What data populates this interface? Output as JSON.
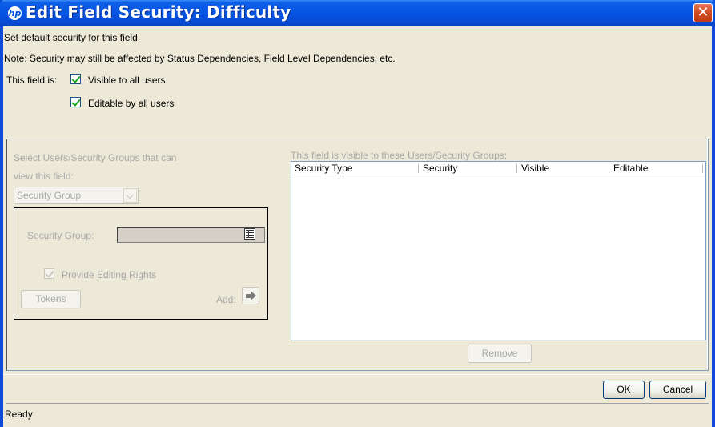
{
  "window": {
    "title": "Edit Field Security: Difficulty",
    "logo_text": "hp"
  },
  "intro": {
    "line1": "Set default security for this field.",
    "line2": "Note: Security may still be affected by Status Dependencies, Field Level Dependencies, etc."
  },
  "defaults": {
    "field_is_label": "This field is:",
    "visible_label": "Visible to all users",
    "visible_checked": true,
    "editable_label": "Editable by all users",
    "editable_checked": true
  },
  "left_panel": {
    "select_label_line1": "Select Users/Security Groups that can",
    "select_label_line2": "view this field:",
    "type_select_value": "Security Group",
    "security_group_label": "Security Group:",
    "security_group_value": "",
    "provide_editing_label": "Provide Editing Rights",
    "provide_editing_checked": true,
    "tokens_button": "Tokens",
    "add_label": "Add:"
  },
  "right_panel": {
    "heading": "This field is visible to these Users/Security Groups:",
    "columns": [
      "Security Type",
      "Security",
      "Visible",
      "Editable"
    ],
    "rows": [],
    "remove_button": "Remove"
  },
  "footer": {
    "ok_button": "OK",
    "cancel_button": "Cancel"
  },
  "status_bar": {
    "text": "Ready"
  },
  "colors": {
    "titlebar": "#0554e3",
    "close": "#d14a23",
    "background": "#ece9d8",
    "disabled_text": "#a9a9a9"
  }
}
